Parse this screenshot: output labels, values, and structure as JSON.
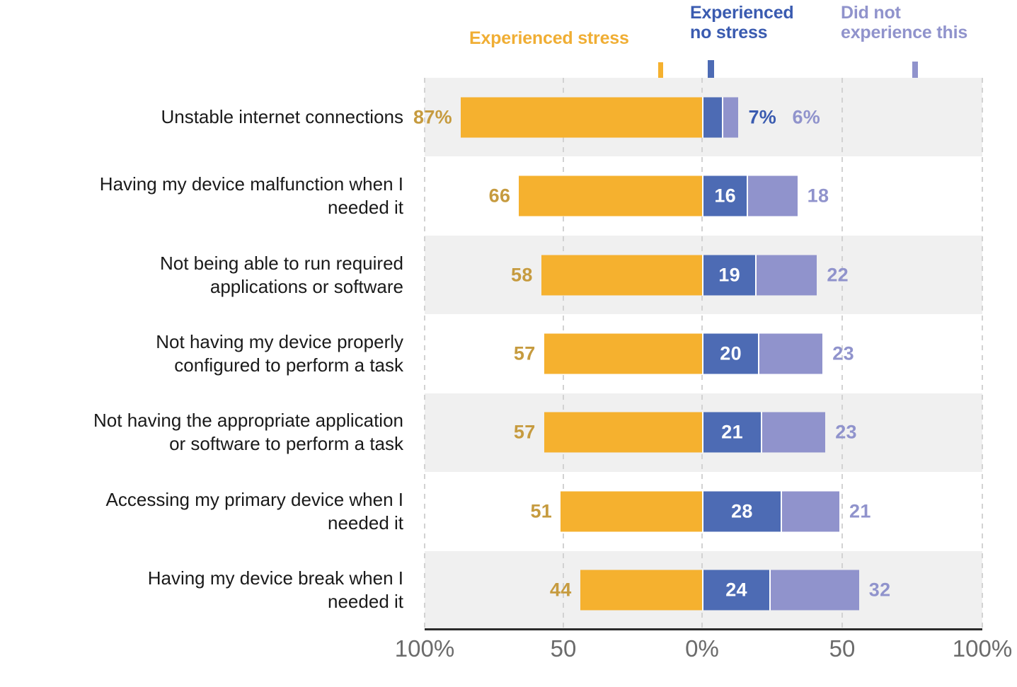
{
  "legend": {
    "series": [
      {
        "key": "stress",
        "label": "Experienced stress",
        "color": "#F0AE34"
      },
      {
        "key": "no_stress",
        "label": "Experienced\nno stress",
        "color": "#3A5BB0"
      },
      {
        "key": "did_not",
        "label": "Did not\nexperience this",
        "color": "#9093CC"
      }
    ]
  },
  "chart_data": {
    "type": "bar",
    "subtype": "diverging-stacked-bar",
    "title": "",
    "xlabel": "",
    "ylabel": "",
    "xlim": [
      -100,
      100
    ],
    "xtick_labels": [
      "100%",
      "50",
      "0%",
      "50",
      "100%"
    ],
    "xtick_values": [
      -100,
      -50,
      0,
      50,
      100
    ],
    "grid": true,
    "legend_position": "top",
    "categories": [
      "Unstable internet connections",
      "Having my device malfunction when I\nneeded it",
      "Not being able to run required\napplications or software",
      "Not having my device properly\nconfigured to perform a task",
      "Not having the appropriate application\nor software to perform a task",
      "Accessing my primary device when I\nneeded it",
      "Having my device break when I\nneeded it"
    ],
    "series": [
      {
        "name": "Experienced stress",
        "color": "#F5B12F",
        "values": [
          87,
          66,
          58,
          57,
          57,
          51,
          44
        ]
      },
      {
        "name": "Experienced no stress",
        "color": "#4D6BB4",
        "values": [
          7,
          16,
          19,
          20,
          21,
          28,
          24
        ]
      },
      {
        "name": "Did not experience this",
        "color": "#9093CC",
        "values": [
          6,
          18,
          22,
          23,
          23,
          21,
          32
        ]
      }
    ],
    "data_labels": {
      "stress": [
        "87%",
        "66",
        "58",
        "57",
        "57",
        "51",
        "44"
      ],
      "no_stress": [
        "7%",
        "16",
        "19",
        "20",
        "21",
        "28",
        "24"
      ],
      "did_not": [
        "6%",
        "18",
        "22",
        "23",
        "23",
        "21",
        "32"
      ]
    },
    "label_placement": {
      "stress": "outside-left",
      "no_stress": [
        "outside-right",
        "inside",
        "inside",
        "inside",
        "inside",
        "inside",
        "inside"
      ],
      "did_not": "outside-right"
    }
  },
  "colors": {
    "orange_bar": "#F5B12F",
    "orange_label": "#C69B3F",
    "orange_legend": "#F0AE34",
    "blue_bar": "#4D6BB4",
    "blue_legend": "#3A5BB0",
    "purple_bar": "#9093CC",
    "band_shaded": "#f0f0f0",
    "band_plain": "#ffffff",
    "gridline": "#d2d2d2",
    "axis": "#2b2b2b",
    "tick_text": "#6b6b6b",
    "category_text": "#1a1a1a"
  }
}
